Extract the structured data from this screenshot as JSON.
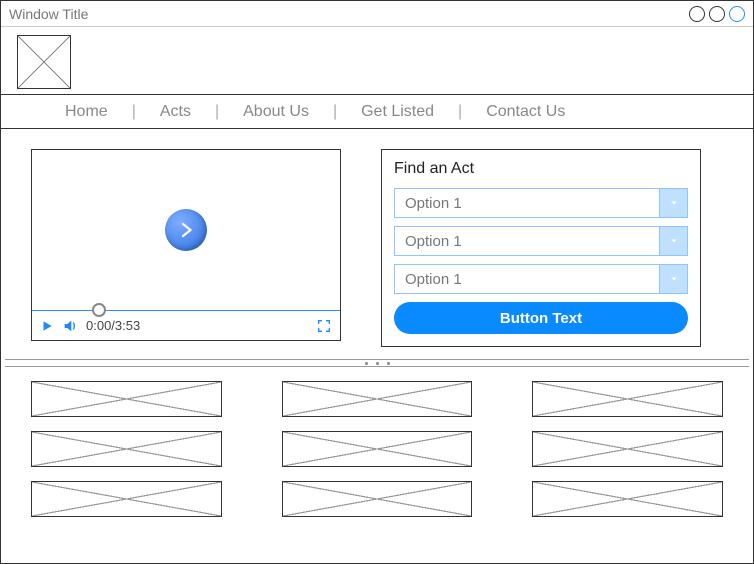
{
  "window": {
    "title": "Window Title"
  },
  "nav": {
    "items": [
      {
        "label": "Home"
      },
      {
        "label": "Acts"
      },
      {
        "label": "About Us"
      },
      {
        "label": "Get Listed"
      },
      {
        "label": "Contact Us"
      }
    ]
  },
  "video": {
    "current_time": "0:00",
    "duration": "3:53",
    "time_display": "0:00/3:53"
  },
  "find": {
    "title": "Find an Act",
    "selects": [
      {
        "selected": "Option 1"
      },
      {
        "selected": "Option 1"
      },
      {
        "selected": "Option 1"
      }
    ],
    "button_label": "Button Text"
  }
}
